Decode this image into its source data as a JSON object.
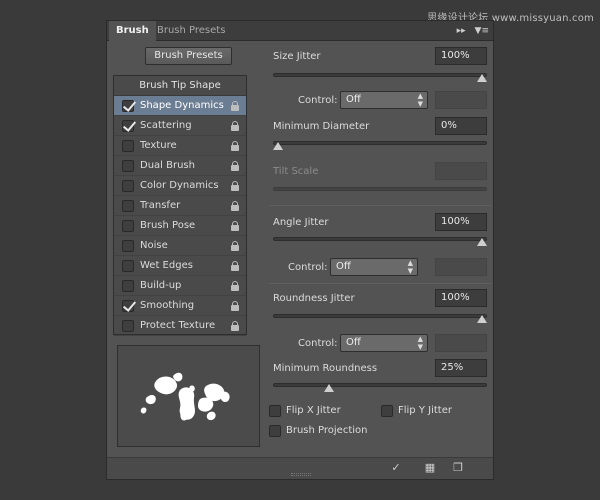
{
  "watermark": "思缘设计论坛 www.missyuan.com",
  "tabs": [
    {
      "label": "Brush",
      "active": true
    },
    {
      "label": "Brush Presets",
      "active": false
    }
  ],
  "panel_icons": {
    "collapse": "double-arrow-icon",
    "menu": "panel-menu-icon"
  },
  "brush_presets_button": "Brush Presets",
  "options_header": "Brush Tip Shape",
  "options": [
    {
      "label": "Shape Dynamics",
      "checked": true,
      "selected": true
    },
    {
      "label": "Scattering",
      "checked": true,
      "selected": false
    },
    {
      "label": "Texture",
      "checked": false,
      "selected": false
    },
    {
      "label": "Dual Brush",
      "checked": false,
      "selected": false
    },
    {
      "label": "Color Dynamics",
      "checked": false,
      "selected": false
    },
    {
      "label": "Transfer",
      "checked": false,
      "selected": false
    },
    {
      "label": "Brush Pose",
      "checked": false,
      "selected": false
    },
    {
      "label": "Noise",
      "checked": false,
      "selected": false
    },
    {
      "label": "Wet Edges",
      "checked": false,
      "selected": false
    },
    {
      "label": "Build-up",
      "checked": false,
      "selected": false
    },
    {
      "label": "Smoothing",
      "checked": true,
      "selected": false
    },
    {
      "label": "Protect Texture",
      "checked": false,
      "selected": false
    }
  ],
  "settings": {
    "size_jitter": {
      "label": "Size Jitter",
      "value": "100%",
      "slider": 1.0
    },
    "control_1": {
      "label": "Control:",
      "value": "Off"
    },
    "minimum_diameter": {
      "label": "Minimum Diameter",
      "value": "0%",
      "slider": 0.0
    },
    "tilt_scale": {
      "label": "Tilt Scale",
      "value": ""
    },
    "angle_jitter": {
      "label": "Angle Jitter",
      "value": "100%",
      "slider": 1.0
    },
    "control_2": {
      "label": "Control:",
      "value": "Off"
    },
    "roundness_jitter": {
      "label": "Roundness Jitter",
      "value": "100%",
      "slider": 1.0
    },
    "control_3": {
      "label": "Control:",
      "value": "Off"
    },
    "minimum_roundness": {
      "label": "Minimum Roundness",
      "value": "25%",
      "slider": 0.25
    },
    "flip_x": {
      "label": "Flip X Jitter",
      "checked": false
    },
    "flip_y": {
      "label": "Flip Y Jitter",
      "checked": false
    },
    "brush_projection": {
      "label": "Brush Projection",
      "checked": false
    }
  },
  "colors": {
    "panel": "#535353",
    "selected": "#6b7d93",
    "background": "#3a3a3a"
  }
}
